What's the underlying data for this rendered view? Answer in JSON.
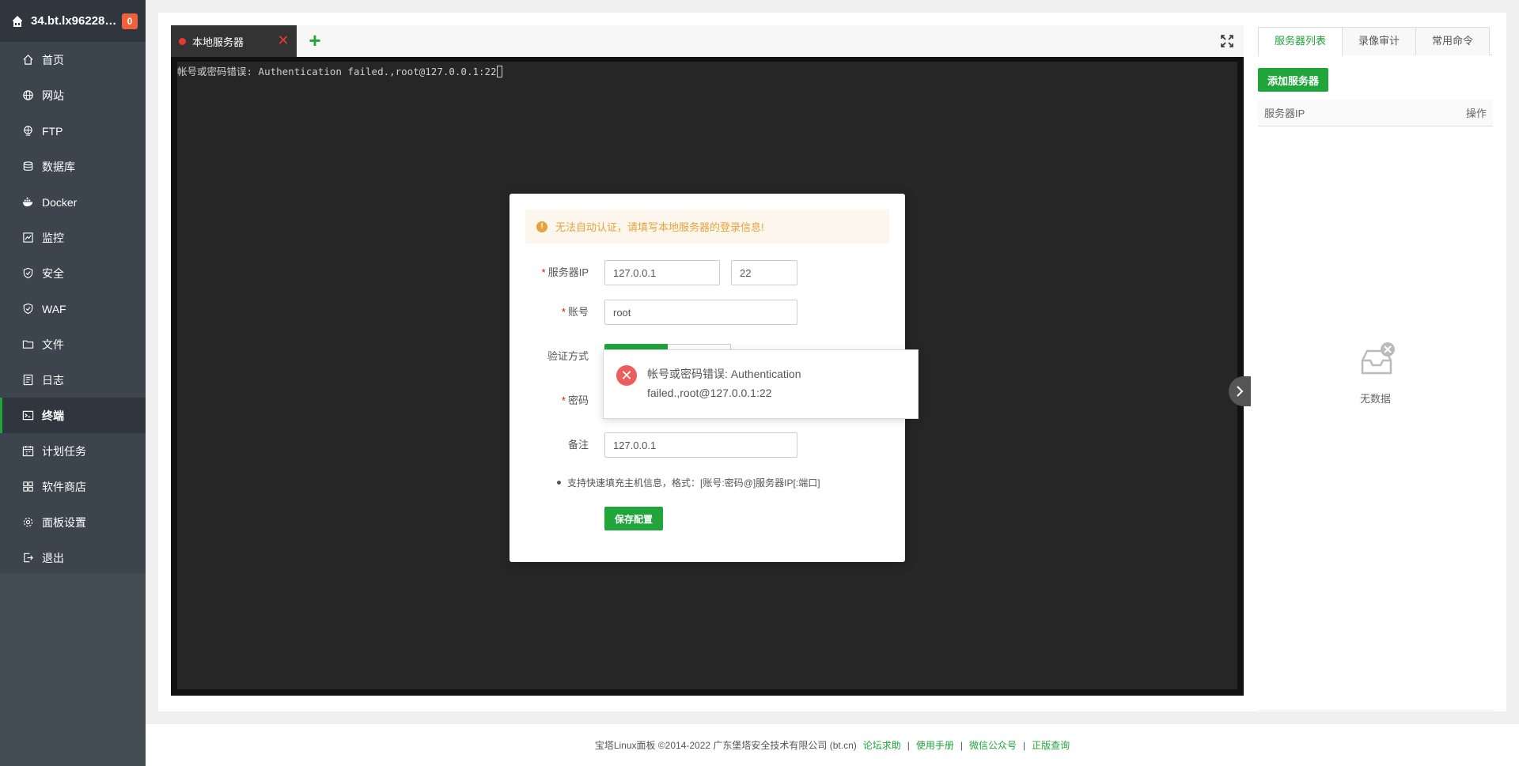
{
  "sidebar": {
    "host": "34.bt.lx96228.c...",
    "badge": "0",
    "items": [
      {
        "label": "首页",
        "icon": "home-icon"
      },
      {
        "label": "网站",
        "icon": "globe-icon"
      },
      {
        "label": "FTP",
        "icon": "ftp-icon"
      },
      {
        "label": "数据库",
        "icon": "database-icon"
      },
      {
        "label": "Docker",
        "icon": "docker-icon"
      },
      {
        "label": "监控",
        "icon": "monitor-icon"
      },
      {
        "label": "安全",
        "icon": "shield-icon"
      },
      {
        "label": "WAF",
        "icon": "waf-shield-icon"
      },
      {
        "label": "文件",
        "icon": "folder-icon"
      },
      {
        "label": "日志",
        "icon": "log-icon"
      },
      {
        "label": "终端",
        "icon": "terminal-icon",
        "active": true
      },
      {
        "label": "计划任务",
        "icon": "calendar-icon"
      },
      {
        "label": "软件商店",
        "icon": "apps-icon"
      },
      {
        "label": "面板设置",
        "icon": "gear-icon"
      },
      {
        "label": "退出",
        "icon": "logout-icon"
      }
    ]
  },
  "terminal": {
    "tab_label": "本地服务器",
    "output_line": "帐号或密码错误: Authentication failed.,root@127.0.0.1:22"
  },
  "right_panel": {
    "tabs": [
      "服务器列表",
      "录像审计",
      "常用命令"
    ],
    "add_button": "添加服务器",
    "col_ip": "服务器IP",
    "col_action": "操作",
    "empty_text": "无数据"
  },
  "modal": {
    "notice": "无法自动认证，请填写本地服务器的登录信息!",
    "label_ip": "服务器IP",
    "ip_value": "127.0.0.1",
    "port_value": "22",
    "label_account": "账号",
    "account_value": "root",
    "label_auth": "验证方式",
    "label_password": "密码",
    "label_remark": "备注",
    "remark_value": "127.0.0.1",
    "tip": "支持快速填充主机信息，格式：[账号:密码@]服务器IP[:端口]",
    "save_button": "保存配置"
  },
  "toast": {
    "message": "帐号或密码错误: Authentication failed.,root@127.0.0.1:22"
  },
  "footer": {
    "copyright": "宝塔Linux面板 ©2014-2022 广东堡塔安全技术有限公司 (bt.cn)",
    "links": [
      "论坛求助",
      "使用手册",
      "微信公众号",
      "正版查询"
    ]
  },
  "colors": {
    "brand_green": "#20a53a",
    "sidebar_bg": "#3c444d",
    "error_red": "#ee5d5d",
    "warning_orange": "#e6a23c"
  }
}
